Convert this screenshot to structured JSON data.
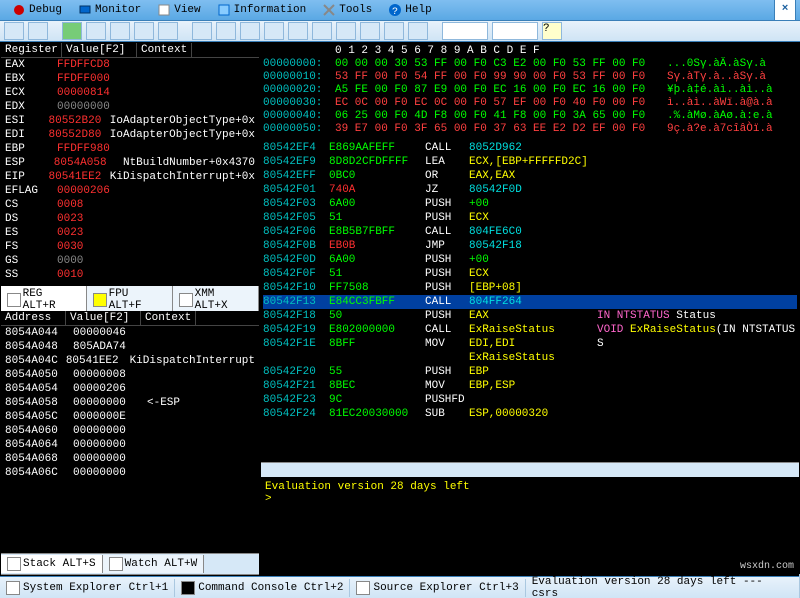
{
  "menubar": {
    "items": [
      {
        "label": "Debug"
      },
      {
        "label": "Monitor"
      },
      {
        "label": "View"
      },
      {
        "label": "Information"
      },
      {
        "label": "Tools"
      },
      {
        "label": "Help"
      }
    ]
  },
  "registers": {
    "headers": [
      "Register",
      "Value[F2]",
      "Context"
    ],
    "rows": [
      {
        "name": "EAX",
        "val": "FFDFFCD8",
        "ctx": "",
        "valcol": "red"
      },
      {
        "name": "EBX",
        "val": "FFDFF000",
        "ctx": "",
        "valcol": "red"
      },
      {
        "name": "ECX",
        "val": "00000814",
        "ctx": "",
        "valcol": "red"
      },
      {
        "name": "EDX",
        "val": "00000000",
        "ctx": "",
        "valcol": "gray"
      },
      {
        "name": "ESI",
        "val": "80552B20",
        "ctx": "IoAdapterObjectType+0x",
        "valcol": "red",
        "ctxcol": "white"
      },
      {
        "name": "EDI",
        "val": "80552D80",
        "ctx": "IoAdapterObjectType+0x",
        "valcol": "red",
        "ctxcol": "white"
      },
      {
        "name": "EBP",
        "val": "FFDFF980",
        "ctx": "",
        "valcol": "red"
      },
      {
        "name": "ESP",
        "val": "8054A058",
        "ctx": "NtBuildNumber+0x4370",
        "valcol": "red",
        "ctxcol": "white"
      },
      {
        "name": "EIP",
        "val": "80541EE2",
        "ctx": "KiDispatchInterrupt+0x",
        "valcol": "red",
        "ctxcol": "white"
      },
      {
        "name": "EFLAG",
        "val": "00000206",
        "ctx": "",
        "valcol": "red"
      },
      {
        "name": "CS",
        "val": "0008",
        "ctx": "",
        "valcol": "red"
      },
      {
        "name": "DS",
        "val": "0023",
        "ctx": "",
        "valcol": "red"
      },
      {
        "name": "ES",
        "val": "0023",
        "ctx": "",
        "valcol": "red"
      },
      {
        "name": "FS",
        "val": "0030",
        "ctx": "",
        "valcol": "red"
      },
      {
        "name": "GS",
        "val": "0000",
        "ctx": "",
        "valcol": "gray"
      },
      {
        "name": "SS",
        "val": "0010",
        "ctx": "",
        "valcol": "red"
      }
    ]
  },
  "regtabs": [
    {
      "label": "REG ALT+R",
      "active": true
    },
    {
      "label": "FPU ALT+F",
      "active": false
    },
    {
      "label": "XMM ALT+X",
      "active": false
    }
  ],
  "memory": {
    "headers": [
      "Address",
      "Value[F2]",
      "Context"
    ],
    "rows": [
      {
        "addr": "8054A044",
        "val": "00000046",
        "ctx": ""
      },
      {
        "addr": "8054A048",
        "val": "805ADA74",
        "ctx": ""
      },
      {
        "addr": "8054A04C",
        "val": "80541EE2",
        "ctx": "KiDispatchInterrupt"
      },
      {
        "addr": "8054A050",
        "val": "00000008",
        "ctx": ""
      },
      {
        "addr": "8054A054",
        "val": "00000206",
        "ctx": ""
      },
      {
        "addr": "8054A058",
        "val": "00000000",
        "ctx": "<-ESP"
      },
      {
        "addr": "8054A05C",
        "val": "0000000E",
        "ctx": ""
      },
      {
        "addr": "8054A060",
        "val": "00000000",
        "ctx": ""
      },
      {
        "addr": "8054A064",
        "val": "00000000",
        "ctx": ""
      },
      {
        "addr": "8054A068",
        "val": "00000000",
        "ctx": ""
      },
      {
        "addr": "8054A06C",
        "val": "00000000",
        "ctx": ""
      }
    ]
  },
  "memtabs": [
    {
      "label": "Stack ALT+S",
      "active": true
    },
    {
      "label": "Watch ALT+W",
      "active": false
    }
  ],
  "hexdump": {
    "hdr": "0  1  2  3  4  5  6  7  8  9  A  B  C  D  E  F",
    "lines": [
      {
        "addr": "00000000:",
        "bytes": "00 00 00 30 53 FF 00 F0 C3 E2 00 F0 53 FF 00 F0",
        "asc": "...0Sγ.àÄ.àSγ.à",
        "col": "green"
      },
      {
        "addr": "00000010:",
        "bytes": "53 FF 00 F0 54 FF 00 F0 99 90 00 F0 53 FF 00 F0",
        "asc": "Sγ.àTγ.à..àSγ.à",
        "col": "red"
      },
      {
        "addr": "00000020:",
        "bytes": "A5 FE 00 F0 87 E9 00 F0 EC 16 00 F0 EC 16 00 F0",
        "asc": "¥þ.à‡é.àì..àì..à",
        "col": "green"
      },
      {
        "addr": "00000030:",
        "bytes": "EC 0C 00 F0 EC 0C 00 F0 57 EF 00 F0 40 F0 00 F0",
        "asc": "ì..àì..àWï.à@à.à",
        "col": "red"
      },
      {
        "addr": "00000040:",
        "bytes": "06 25 00 F0 4D F8 00 F0 41 F8 00 F0 3A 65 00 F0",
        "asc": ".%.àMø.àAø.à:e.à",
        "col": "green"
      },
      {
        "addr": "00000050:",
        "bytes": "39 E7 00 F0 3F 65 00 F0 37 63 EE E2 D2 EF 00 F0",
        "asc": "9ç.à?e.à7cîâÒï.à",
        "col": "red"
      }
    ]
  },
  "disasm": {
    "rows": [
      {
        "addr": "80542EF4",
        "bytes": "E869AAFEFF",
        "bcol": "green",
        "mnem": "CALL",
        "ops": "8052D962",
        "opscol": "cyan"
      },
      {
        "addr": "80542EF9",
        "bytes": "8D8D2CFDFFFF",
        "bcol": "green",
        "mnem": "LEA",
        "ops": "ECX,[EBP+FFFFFD2C]",
        "opscol": "yellow"
      },
      {
        "addr": "80542EFF",
        "bytes": "0BC0",
        "bcol": "green",
        "mnem": "OR",
        "ops": "EAX,EAX",
        "opscol": "yellow"
      },
      {
        "addr": "80542F01",
        "bytes": "740A",
        "bcol": "red",
        "mnem": "JZ",
        "ops": "80542F0D",
        "opscol": "cyan"
      },
      {
        "addr": "80542F03",
        "bytes": "6A00",
        "bcol": "green",
        "mnem": "PUSH",
        "ops": "+00",
        "opscol": "green"
      },
      {
        "addr": "80542F05",
        "bytes": "51",
        "bcol": "green",
        "mnem": "PUSH",
        "ops": "ECX",
        "opscol": "yellow"
      },
      {
        "addr": "80542F06",
        "bytes": "E8B5B7FBFF",
        "bcol": "green",
        "mnem": "CALL",
        "ops": "804FE6C0",
        "opscol": "cyan"
      },
      {
        "addr": "80542F0B",
        "bytes": "EB0B",
        "bcol": "red",
        "mnem": "JMP",
        "ops": "80542F18",
        "opscol": "cyan"
      },
      {
        "addr": "80542F0D",
        "bytes": "6A00",
        "bcol": "green",
        "mnem": "PUSH",
        "ops": "+00",
        "opscol": "green"
      },
      {
        "addr": "80542F0F",
        "bytes": "51",
        "bcol": "green",
        "mnem": "PUSH",
        "ops": "ECX",
        "opscol": "yellow"
      },
      {
        "addr": "80542F10",
        "bytes": "FF7508",
        "bcol": "green",
        "mnem": "PUSH",
        "ops": "[EBP+08]",
        "opscol": "yellow"
      },
      {
        "addr": "80542F13",
        "bytes": "E84CC3FBFF",
        "bcol": "green",
        "mnem": "CALL",
        "ops": "804FF264",
        "opscol": "cyan",
        "sel": true
      },
      {
        "addr": "80542F18",
        "bytes": "50",
        "bcol": "green",
        "mnem": "PUSH",
        "ops": "EAX",
        "opscol": "yellow"
      },
      {
        "addr": "80542F19",
        "bytes": "E802000000",
        "bcol": "green",
        "mnem": "CALL",
        "ops": "ExRaiseStatus",
        "opscol": "yellow"
      },
      {
        "addr": "80542F1E",
        "bytes": "8BFF",
        "bcol": "green",
        "mnem": "MOV",
        "ops": "EDI,EDI",
        "opscol": "yellow"
      },
      {
        "addr": "",
        "bytes": "",
        "bcol": "",
        "mnem": "",
        "ops": "ExRaiseStatus",
        "opscol": "yellow"
      },
      {
        "addr": "80542F20",
        "bytes": "55",
        "bcol": "green",
        "mnem": "PUSH",
        "ops": "EBP",
        "opscol": "yellow"
      },
      {
        "addr": "80542F21",
        "bytes": "8BEC",
        "bcol": "green",
        "mnem": "MOV",
        "ops": "EBP,ESP",
        "opscol": "yellow"
      },
      {
        "addr": "80542F23",
        "bytes": "9C",
        "bcol": "green",
        "mnem": "PUSHFD",
        "ops": "",
        "opscol": ""
      },
      {
        "addr": "80542F24",
        "bytes": "81EC20030000",
        "bcol": "green",
        "mnem": "SUB",
        "ops": "ESP,00000320",
        "opscol": "yellow"
      }
    ]
  },
  "annot": {
    "line1_a": "IN NTSTATUS",
    "line1_b": " Status",
    "line2_a": "VOID ",
    "line2_b": "ExRaiseStatus",
    "line2_c": "(IN NTSTATUS S"
  },
  "console": {
    "line1": "Evaluation version 28 days left",
    "prompt": ">"
  },
  "statusbar": {
    "items": [
      "System Explorer Ctrl+1",
      "Command Console Ctrl+2",
      "Source Explorer Ctrl+3"
    ],
    "trail": "Evaluation version 28 days left --- csrs"
  },
  "watermark": "wsxdn.com"
}
